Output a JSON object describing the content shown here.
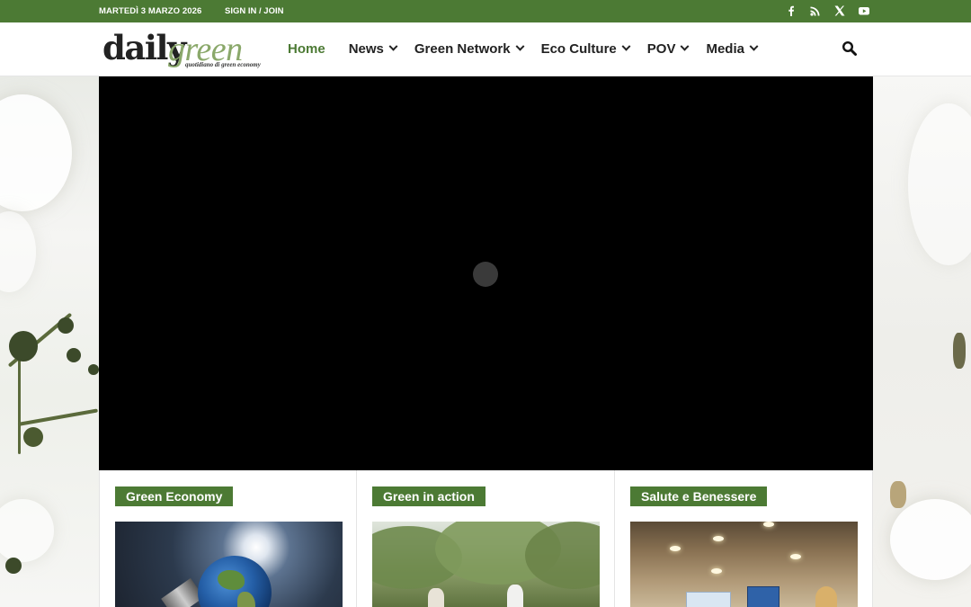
{
  "topbar": {
    "date": "MARTEDÌ 3 MARZO 2026",
    "signin": "SIGN IN / JOIN",
    "social": [
      "facebook-icon",
      "rss-icon",
      "x-icon",
      "youtube-icon"
    ]
  },
  "logo": {
    "daily": "daily",
    "green": "green",
    "tagline": "quotidiano di green economy"
  },
  "nav": {
    "items": [
      {
        "label": "Home",
        "active": true
      },
      {
        "label": "News"
      },
      {
        "label": "Green Network"
      },
      {
        "label": "Eco Culture"
      },
      {
        "label": "POV"
      },
      {
        "label": "Media"
      }
    ]
  },
  "sections": [
    {
      "label": "Green Economy"
    },
    {
      "label": "Green in action"
    },
    {
      "label": "Salute e Benessere"
    }
  ],
  "colors": {
    "brand": "#4c7a34",
    "logo_green": "#8aa86a",
    "video_bg": "#000000"
  }
}
